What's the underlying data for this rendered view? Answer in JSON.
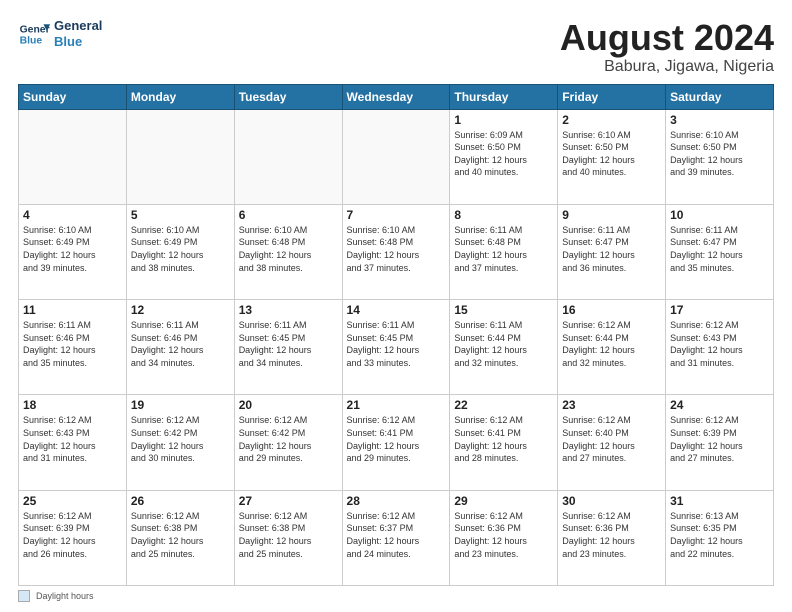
{
  "logo": {
    "line1": "General",
    "line2": "Blue"
  },
  "title": "August 2024",
  "subtitle": "Babura, Jigawa, Nigeria",
  "days_of_week": [
    "Sunday",
    "Monday",
    "Tuesday",
    "Wednesday",
    "Thursday",
    "Friday",
    "Saturday"
  ],
  "footer_label": "Daylight hours",
  "weeks": [
    [
      {
        "day": "",
        "info": ""
      },
      {
        "day": "",
        "info": ""
      },
      {
        "day": "",
        "info": ""
      },
      {
        "day": "",
        "info": ""
      },
      {
        "day": "1",
        "info": "Sunrise: 6:09 AM\nSunset: 6:50 PM\nDaylight: 12 hours\nand 40 minutes."
      },
      {
        "day": "2",
        "info": "Sunrise: 6:10 AM\nSunset: 6:50 PM\nDaylight: 12 hours\nand 40 minutes."
      },
      {
        "day": "3",
        "info": "Sunrise: 6:10 AM\nSunset: 6:50 PM\nDaylight: 12 hours\nand 39 minutes."
      }
    ],
    [
      {
        "day": "4",
        "info": "Sunrise: 6:10 AM\nSunset: 6:49 PM\nDaylight: 12 hours\nand 39 minutes."
      },
      {
        "day": "5",
        "info": "Sunrise: 6:10 AM\nSunset: 6:49 PM\nDaylight: 12 hours\nand 38 minutes."
      },
      {
        "day": "6",
        "info": "Sunrise: 6:10 AM\nSunset: 6:48 PM\nDaylight: 12 hours\nand 38 minutes."
      },
      {
        "day": "7",
        "info": "Sunrise: 6:10 AM\nSunset: 6:48 PM\nDaylight: 12 hours\nand 37 minutes."
      },
      {
        "day": "8",
        "info": "Sunrise: 6:11 AM\nSunset: 6:48 PM\nDaylight: 12 hours\nand 37 minutes."
      },
      {
        "day": "9",
        "info": "Sunrise: 6:11 AM\nSunset: 6:47 PM\nDaylight: 12 hours\nand 36 minutes."
      },
      {
        "day": "10",
        "info": "Sunrise: 6:11 AM\nSunset: 6:47 PM\nDaylight: 12 hours\nand 35 minutes."
      }
    ],
    [
      {
        "day": "11",
        "info": "Sunrise: 6:11 AM\nSunset: 6:46 PM\nDaylight: 12 hours\nand 35 minutes."
      },
      {
        "day": "12",
        "info": "Sunrise: 6:11 AM\nSunset: 6:46 PM\nDaylight: 12 hours\nand 34 minutes."
      },
      {
        "day": "13",
        "info": "Sunrise: 6:11 AM\nSunset: 6:45 PM\nDaylight: 12 hours\nand 34 minutes."
      },
      {
        "day": "14",
        "info": "Sunrise: 6:11 AM\nSunset: 6:45 PM\nDaylight: 12 hours\nand 33 minutes."
      },
      {
        "day": "15",
        "info": "Sunrise: 6:11 AM\nSunset: 6:44 PM\nDaylight: 12 hours\nand 32 minutes."
      },
      {
        "day": "16",
        "info": "Sunrise: 6:12 AM\nSunset: 6:44 PM\nDaylight: 12 hours\nand 32 minutes."
      },
      {
        "day": "17",
        "info": "Sunrise: 6:12 AM\nSunset: 6:43 PM\nDaylight: 12 hours\nand 31 minutes."
      }
    ],
    [
      {
        "day": "18",
        "info": "Sunrise: 6:12 AM\nSunset: 6:43 PM\nDaylight: 12 hours\nand 31 minutes."
      },
      {
        "day": "19",
        "info": "Sunrise: 6:12 AM\nSunset: 6:42 PM\nDaylight: 12 hours\nand 30 minutes."
      },
      {
        "day": "20",
        "info": "Sunrise: 6:12 AM\nSunset: 6:42 PM\nDaylight: 12 hours\nand 29 minutes."
      },
      {
        "day": "21",
        "info": "Sunrise: 6:12 AM\nSunset: 6:41 PM\nDaylight: 12 hours\nand 29 minutes."
      },
      {
        "day": "22",
        "info": "Sunrise: 6:12 AM\nSunset: 6:41 PM\nDaylight: 12 hours\nand 28 minutes."
      },
      {
        "day": "23",
        "info": "Sunrise: 6:12 AM\nSunset: 6:40 PM\nDaylight: 12 hours\nand 27 minutes."
      },
      {
        "day": "24",
        "info": "Sunrise: 6:12 AM\nSunset: 6:39 PM\nDaylight: 12 hours\nand 27 minutes."
      }
    ],
    [
      {
        "day": "25",
        "info": "Sunrise: 6:12 AM\nSunset: 6:39 PM\nDaylight: 12 hours\nand 26 minutes."
      },
      {
        "day": "26",
        "info": "Sunrise: 6:12 AM\nSunset: 6:38 PM\nDaylight: 12 hours\nand 25 minutes."
      },
      {
        "day": "27",
        "info": "Sunrise: 6:12 AM\nSunset: 6:38 PM\nDaylight: 12 hours\nand 25 minutes."
      },
      {
        "day": "28",
        "info": "Sunrise: 6:12 AM\nSunset: 6:37 PM\nDaylight: 12 hours\nand 24 minutes."
      },
      {
        "day": "29",
        "info": "Sunrise: 6:12 AM\nSunset: 6:36 PM\nDaylight: 12 hours\nand 23 minutes."
      },
      {
        "day": "30",
        "info": "Sunrise: 6:12 AM\nSunset: 6:36 PM\nDaylight: 12 hours\nand 23 minutes."
      },
      {
        "day": "31",
        "info": "Sunrise: 6:13 AM\nSunset: 6:35 PM\nDaylight: 12 hours\nand 22 minutes."
      }
    ]
  ]
}
